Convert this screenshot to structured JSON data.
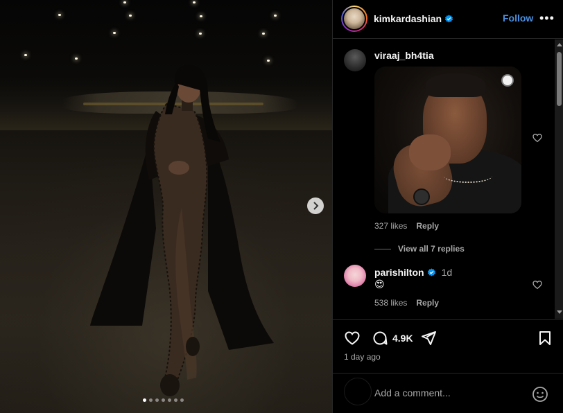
{
  "post": {
    "photo_alt_colors": {
      "background": "#1f1b15",
      "figure": "#0d0b09"
    },
    "carousel": {
      "total": 7,
      "active": 0
    }
  },
  "header": {
    "username": "kimkardashian",
    "verified": true,
    "follow_label": "Follow",
    "more_label": "•••"
  },
  "comments": [
    {
      "username": "viraaj_bh4tia",
      "content_type": "gif",
      "likes": "327 likes",
      "reply_label": "Reply",
      "view_replies": "View all 7 replies"
    },
    {
      "username": "parishilton",
      "verified": true,
      "time": "1d",
      "text": "😍",
      "likes": "538 likes",
      "reply_label": "Reply"
    }
  ],
  "actions": {
    "comment_count": "4.9K",
    "time_ago": "1 day ago"
  },
  "add_comment": {
    "placeholder": "Add a comment..."
  },
  "colors": {
    "accent": "#4a90e2",
    "verified": "#0095f6",
    "muted": "#a8a8a8",
    "divider": "#262626"
  }
}
